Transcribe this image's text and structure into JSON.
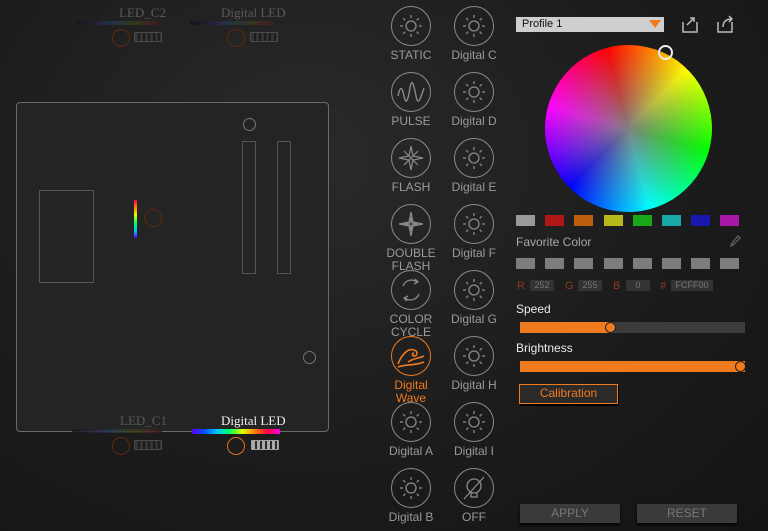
{
  "headers": {
    "top_left": {
      "name": "LED_C2"
    },
    "top_right": {
      "name": "Digital LED"
    },
    "bottom_left": {
      "name": "LED_C1"
    },
    "bottom_right": {
      "name": "Digital LED"
    }
  },
  "effects": [
    {
      "label": "STATIC",
      "icon": "static-sun-icon"
    },
    {
      "label": "PULSE",
      "icon": "pulse-wave-icon"
    },
    {
      "label": "FLASH",
      "icon": "flash-star-icon"
    },
    {
      "label": "DOUBLE FLASH",
      "icon": "double-flash-star-icon"
    },
    {
      "label": "COLOR CYCLE",
      "icon": "color-cycle-icon"
    },
    {
      "label": "Digital Wave",
      "icon": "digital-wave-icon",
      "active": true
    },
    {
      "label": "Digital A",
      "icon": "sun-icon"
    },
    {
      "label": "Digital B",
      "icon": "sun-icon"
    },
    {
      "label": "Digital C",
      "icon": "sun-icon"
    },
    {
      "label": "Digital D",
      "icon": "sun-icon"
    },
    {
      "label": "Digital E",
      "icon": "sun-icon"
    },
    {
      "label": "Digital F",
      "icon": "sun-icon"
    },
    {
      "label": "Digital G",
      "icon": "sun-icon"
    },
    {
      "label": "Digital H",
      "icon": "sun-icon"
    },
    {
      "label": "Digital I",
      "icon": "sun-icon"
    },
    {
      "label": "OFF",
      "icon": "off-icon"
    }
  ],
  "profile": {
    "selected": "Profile 1"
  },
  "swatches": [
    "#9a9a9a",
    "#b01818",
    "#c05e10",
    "#b8b818",
    "#18a818",
    "#18a8a8",
    "#1818b0",
    "#a818a8"
  ],
  "favorite_label": "Favorite Color",
  "rgb": {
    "r_label": "R",
    "r": "252",
    "g_label": "G",
    "g": "255",
    "b_label": "B",
    "b": "0",
    "hex_label": "#",
    "hex": "FCFF00"
  },
  "speed": {
    "label": "Speed",
    "value": 0.4
  },
  "brightness": {
    "label": "Brightness",
    "value": 1.0
  },
  "calibration_label": "Calibration",
  "apply_label": "APPLY",
  "reset_label": "RESET",
  "accent_color": "#f07a1e"
}
